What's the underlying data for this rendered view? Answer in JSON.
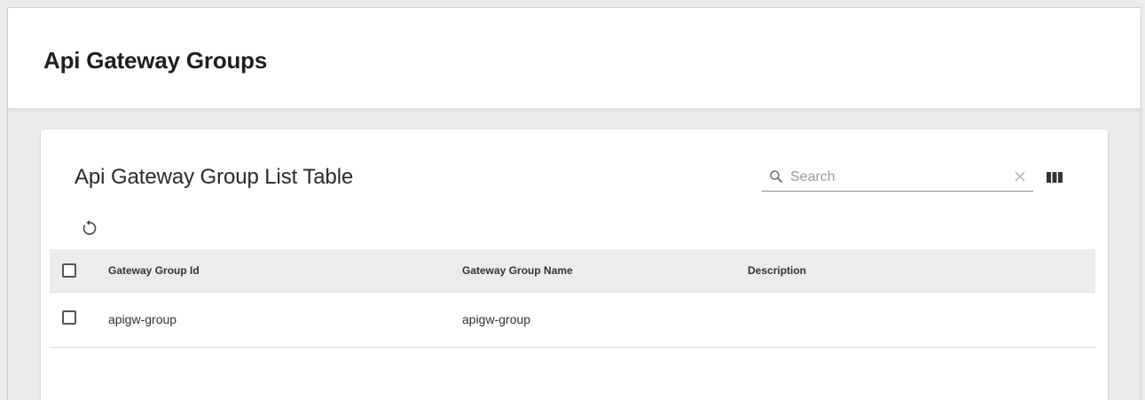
{
  "header": {
    "title": "Api Gateway Groups"
  },
  "table": {
    "title": "Api Gateway Group List Table",
    "search": {
      "placeholder": "Search",
      "value": "",
      "icon": "search-icon",
      "clear_icon": "close-icon"
    },
    "toolbar": {
      "columns_icon": "view-columns-icon",
      "refresh_icon": "refresh-icon"
    },
    "columns": [
      "Gateway Group Id",
      "Gateway Group Name",
      "Description"
    ],
    "rows": [
      {
        "id": "apigw-group",
        "name": "apigw-group",
        "description": ""
      }
    ]
  },
  "colors": {
    "page_bg": "#ebebeb",
    "card_bg": "#ffffff",
    "header_row_bg": "#ececec",
    "text": "#212121"
  }
}
